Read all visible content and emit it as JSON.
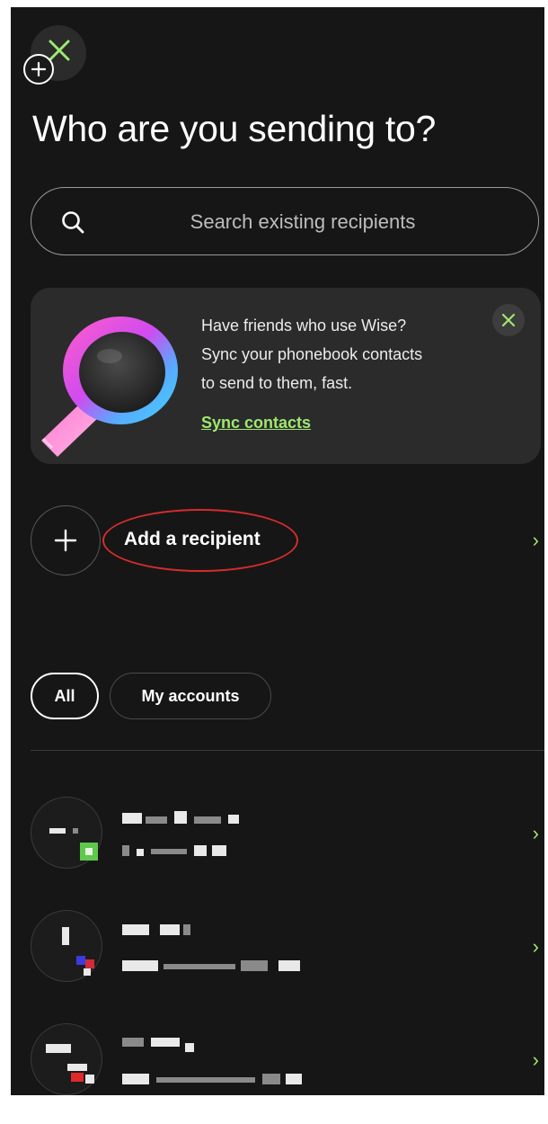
{
  "header": {
    "title": "Who are you sending to?"
  },
  "search": {
    "placeholder": "Search existing recipients"
  },
  "promo": {
    "lines": [
      "Have friends who use Wise?",
      "Sync your phonebook contacts",
      "to send to them, fast."
    ],
    "link": "Sync contacts"
  },
  "add_recipient": {
    "label": "Add a recipient"
  },
  "filters": {
    "all": "All",
    "my_accounts": "My accounts"
  },
  "icons": {
    "close": "close-icon",
    "add": "plus-icon",
    "search": "search-icon",
    "chevron": "chevron-right-icon",
    "illustration": "magnifying-glass-illustration"
  },
  "colors": {
    "background": "#161616",
    "accent": "#9fe870",
    "annotation": "#d62c2c"
  },
  "chevron_glyph": "›"
}
